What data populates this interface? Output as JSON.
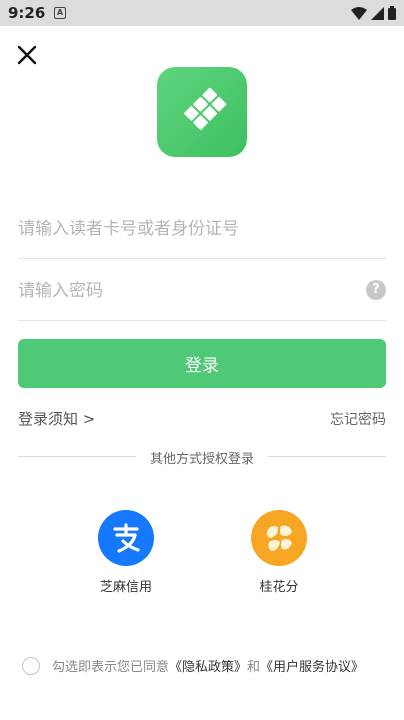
{
  "status_bar": {
    "time": "9:26",
    "notification_glyph": "A",
    "icons": [
      "wifi-icon",
      "signal-icon",
      "battery-icon"
    ]
  },
  "header": {
    "close_icon": "close-icon"
  },
  "logo": {
    "icon": "library-app-logo",
    "color": "#4cc96f"
  },
  "form": {
    "account_placeholder": "请输入读者卡号或者身份证号",
    "account_value": "",
    "password_placeholder": "请输入密码",
    "password_value": "",
    "help_glyph": "?",
    "login_label": "登录"
  },
  "links": {
    "notice": "登录须知 >",
    "forgot_password": "忘记密码"
  },
  "other_login": {
    "divider_text": "其他方式授权登录",
    "providers": [
      {
        "label": "芝麻信用",
        "icon": "alipay-icon",
        "color": "#1677ff"
      },
      {
        "label": "桂花分",
        "icon": "osmanthus-icon",
        "color": "#f6a623"
      }
    ]
  },
  "agreement": {
    "prefix": "勾选即表示您已同意",
    "privacy_link": "《隐私政策》",
    "conjunction": "和",
    "terms_link": "《用户服务协议》"
  },
  "theme": {
    "accent": "#4fc976"
  }
}
